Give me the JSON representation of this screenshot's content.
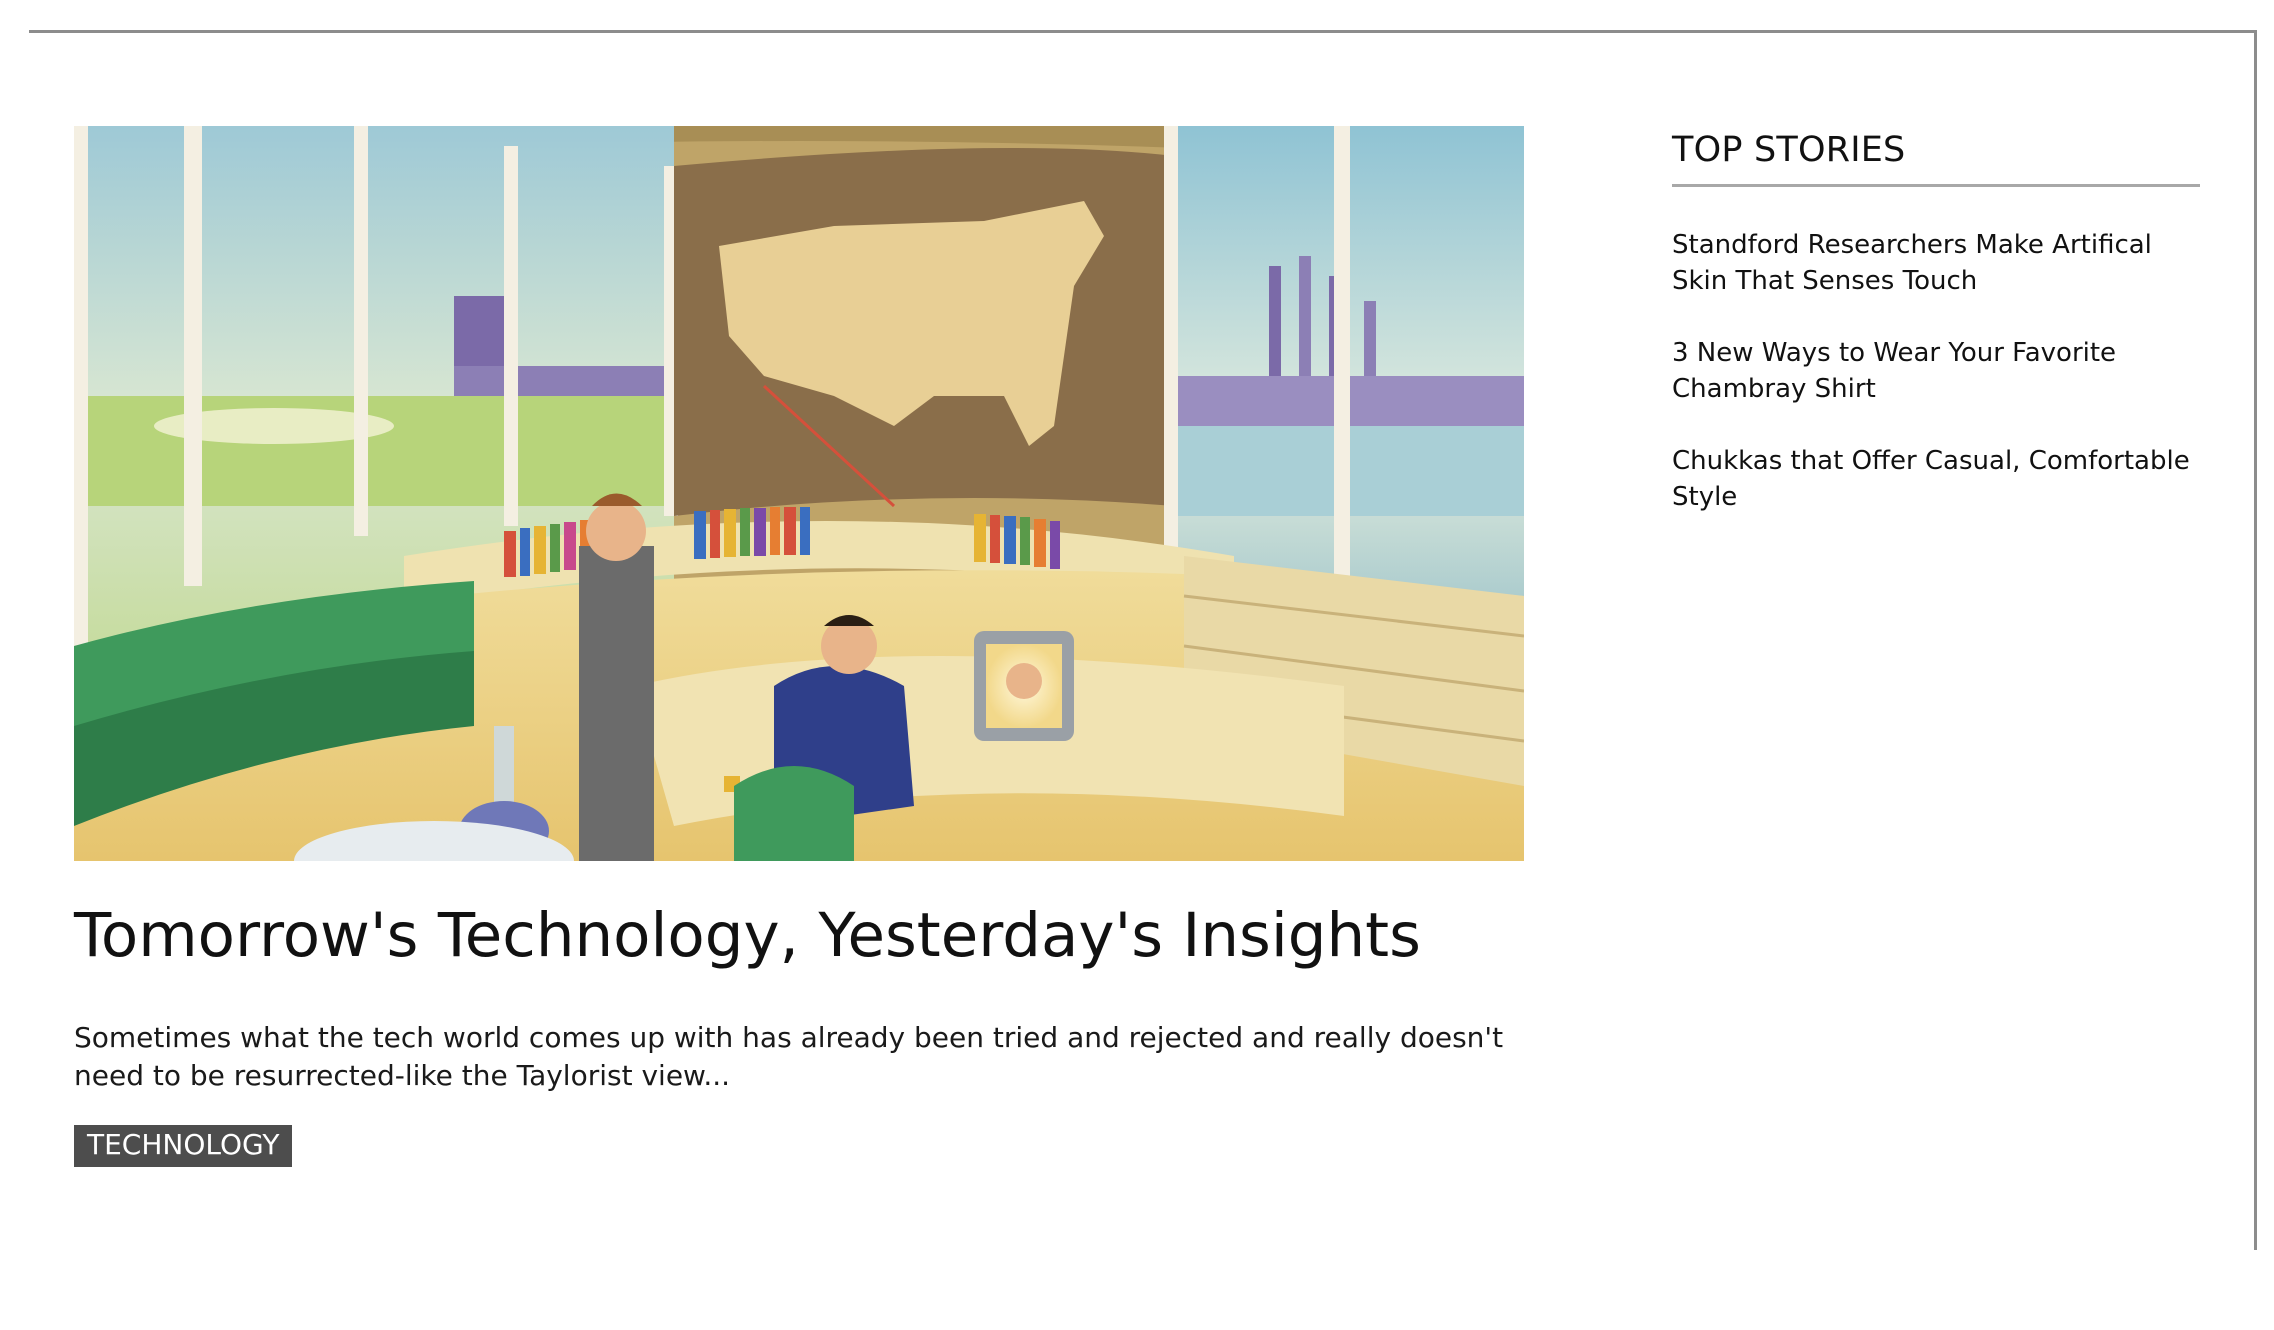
{
  "article": {
    "image_alt": "Retro illustration of two men in a futuristic control room with a map of the United States",
    "headline": "Tomorrow's Technology, Yesterday's Insights",
    "excerpt": "Sometimes what the tech world comes up with has already been tried and rejected and really doesn't need to be resurrected-like the Taylorist view...",
    "category": "TECHNOLOGY"
  },
  "sidebar": {
    "title": "TOP STORIES",
    "stories": [
      {
        "title": "Standford Researchers Make Artifical Skin That Senses Touch"
      },
      {
        "title": "3 New Ways to Wear Your Favorite Chambray Shirt"
      },
      {
        "title": "Chukkas that Offer Casual, Comfortable Style"
      }
    ]
  },
  "colors": {
    "tag_background": "#4d4d4d",
    "frame_border": "#8c8c8c",
    "sidebar_rule": "#a8a8a8"
  }
}
